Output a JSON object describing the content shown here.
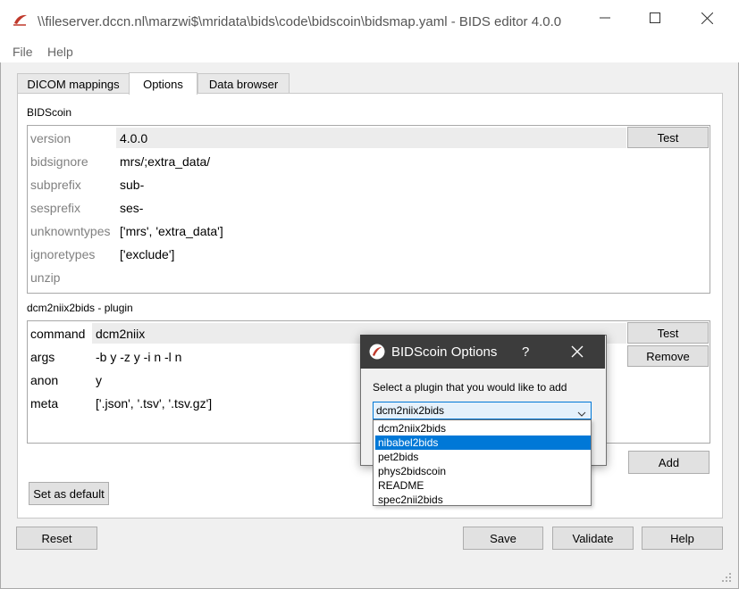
{
  "window": {
    "title": "\\\\fileserver.dccn.nl\\marzwi$\\mridata\\bids\\code\\bidscoin\\bidsmap.yaml - BIDS editor 4.0.0"
  },
  "menu": {
    "file": "File",
    "help": "Help"
  },
  "tabs": [
    "DICOM mappings",
    "Options",
    "Data browser"
  ],
  "bidscoin": {
    "label": "BIDScoin",
    "test_label": "Test",
    "rows": [
      {
        "key": "version",
        "value": "4.0.0"
      },
      {
        "key": "bidsignore",
        "value": "mrs/;extra_data/"
      },
      {
        "key": "subprefix",
        "value": "sub-"
      },
      {
        "key": "sesprefix",
        "value": "ses-"
      },
      {
        "key": "unknowntypes",
        "value": "['mrs', 'extra_data']"
      },
      {
        "key": "ignoretypes",
        "value": "['exclude']"
      },
      {
        "key": "unzip",
        "value": ""
      }
    ]
  },
  "plugin": {
    "label": "dcm2niix2bids - plugin",
    "test_label": "Test",
    "remove_label": "Remove",
    "rows": [
      {
        "key": "command",
        "value": "dcm2niix"
      },
      {
        "key": "args",
        "value": "-b y -z y -i n -l n"
      },
      {
        "key": "anon",
        "value": "y"
      },
      {
        "key": "meta",
        "value": "['.json', '.tsv', '.tsv.gz']"
      }
    ]
  },
  "buttons": {
    "add": "Add",
    "set_default": "Set as default",
    "reset": "Reset",
    "save": "Save",
    "validate": "Validate",
    "help": "Help"
  },
  "dialog": {
    "title": "BIDScoin Options",
    "help_glyph": "?",
    "prompt": "Select a plugin that you would like to add",
    "selected": "dcm2niix2bids",
    "options": [
      "dcm2niix2bids",
      "nibabel2bids",
      "pet2bids",
      "phys2bidscoin",
      "README",
      "spec2nii2bids"
    ],
    "highlighted_index": 1
  }
}
